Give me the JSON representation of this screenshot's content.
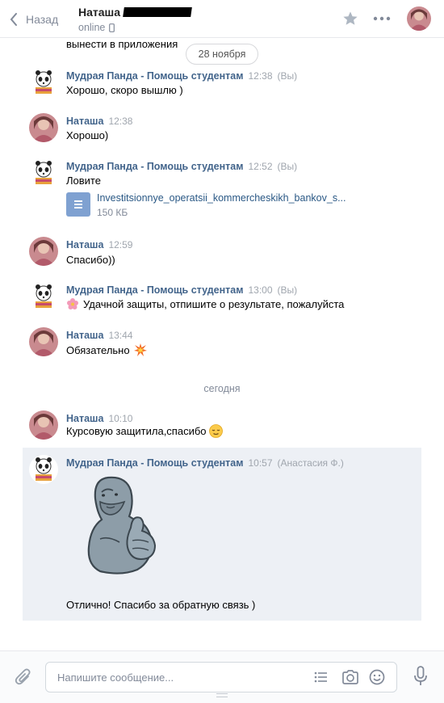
{
  "header": {
    "back_label": "Назад",
    "peer_name": "Наташа",
    "peer_status": "online"
  },
  "top": {
    "prev_text": "вынести в приложения",
    "date_pill": "28 ноября"
  },
  "messages": [
    {
      "author": "Мудрая Панда - Помощь студентам",
      "time": "12:38",
      "tag": "(Вы)",
      "text": "Хорошо, скоро вышлю )"
    },
    {
      "author": "Наташа",
      "time": "12:38",
      "text": "Хорошо)"
    },
    {
      "author": "Мудрая Панда - Помощь студентам",
      "time": "12:52",
      "tag": "(Вы)",
      "text": "Ловите",
      "file": {
        "name": "Investitsionnye_operatsii_kommercheskikh_bankov_s...",
        "size": "150 КБ"
      }
    },
    {
      "author": "Наташа",
      "time": "12:59",
      "text": "Спасибо))"
    },
    {
      "author": "Мудрая Панда - Помощь студентам",
      "time": "13:00",
      "tag": "(Вы)",
      "text": "Удачной защиты, отпишите о результате, пожалуйста"
    },
    {
      "author": "Наташа",
      "time": "13:44",
      "text": "Обязательно"
    },
    {
      "author": "Наташа",
      "time": "10:10",
      "text": "Курсовую защитила,спасибо"
    },
    {
      "author": "Мудрая Панда - Помощь студентам",
      "time": "10:57",
      "tag": "(Анастасия Ф.)",
      "text": "Отлично! Спасибо за обратную связь )"
    }
  ],
  "day_separator": "сегодня",
  "composer": {
    "placeholder": "Напишите сообщение..."
  },
  "icons": {
    "back": "chevron-left-icon",
    "star": "star-icon",
    "more": "more-dots-icon",
    "phone": "mobile-phone-icon",
    "file": "document-icon",
    "attach": "paperclip-icon",
    "list": "list-icon",
    "camera": "camera-icon",
    "smile": "smile-icon",
    "mic": "microphone-icon"
  },
  "colors": {
    "author": "#42648b",
    "link": "#2a5885",
    "selected_bg": "#edf0f5",
    "muted": "#828a99"
  }
}
